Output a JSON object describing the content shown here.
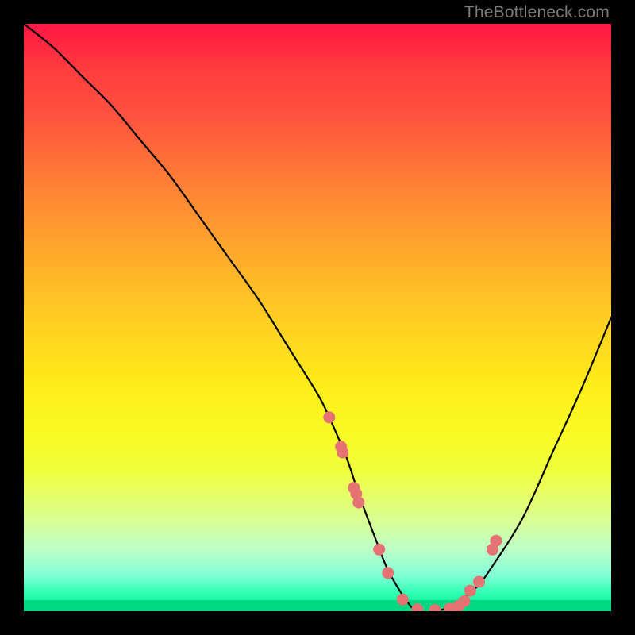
{
  "watermark": "TheBottleneck.com",
  "colors": {
    "curve": "#000000",
    "dot_fill": "#e57373",
    "dot_stroke": "#d86060"
  },
  "chart_data": {
    "type": "line",
    "title": "",
    "xlabel": "",
    "ylabel": "",
    "xlim": [
      0,
      100
    ],
    "ylim": [
      0,
      100
    ],
    "grid": false,
    "legend": false,
    "series": [
      {
        "name": "bottleneck-curve",
        "x": [
          0,
          5,
          10,
          15,
          20,
          25,
          30,
          35,
          40,
          45,
          50,
          52,
          55,
          57,
          60,
          62,
          65,
          67,
          70,
          73,
          77,
          80,
          85,
          90,
          95,
          100
        ],
        "y": [
          100,
          96,
          91,
          86,
          80,
          74,
          67,
          60,
          53,
          45,
          37,
          33,
          26,
          20,
          12,
          7,
          2,
          0,
          0,
          1,
          4,
          8,
          16,
          27,
          38,
          50
        ]
      }
    ],
    "scatter_points": {
      "name": "highlight-dots",
      "x": [
        52.0,
        54.0,
        54.3,
        56.2,
        56.6,
        57.0,
        60.5,
        62.0,
        64.5,
        67.0,
        70.0,
        72.5,
        74.0,
        75.0,
        76.0,
        77.5,
        79.8,
        80.4
      ],
      "y": [
        33.0,
        28.0,
        27.0,
        21.0,
        20.0,
        18.5,
        10.5,
        6.5,
        2.0,
        0.3,
        0.2,
        0.4,
        0.9,
        1.7,
        3.5,
        5.0,
        10.5,
        12.0
      ]
    }
  }
}
